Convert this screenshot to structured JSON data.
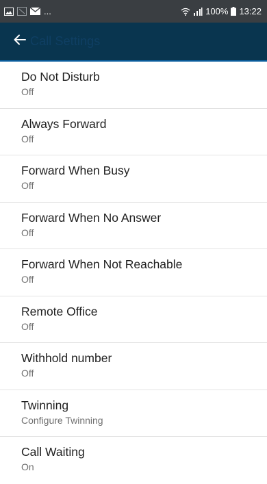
{
  "status_bar": {
    "dots": "...",
    "battery_percent": "100%",
    "time": "13:22",
    "icons": [
      "gallery-icon",
      "image-icon",
      "mail-icon",
      "wifi-icon",
      "signal-icon",
      "battery-icon"
    ]
  },
  "app_bar": {
    "back_icon": "arrow-left-icon",
    "title": "Call Settings",
    "background": "#09354f"
  },
  "settings": [
    {
      "title": "Do Not Disturb",
      "value": "Off"
    },
    {
      "title": "Always Forward",
      "value": "Off"
    },
    {
      "title": "Forward When Busy",
      "value": "Off"
    },
    {
      "title": "Forward When No Answer",
      "value": "Off"
    },
    {
      "title": "Forward When Not Reachable",
      "value": "Off"
    },
    {
      "title": "Remote Office",
      "value": "Off"
    },
    {
      "title": "Withhold number",
      "value": "Off"
    },
    {
      "title": "Twinning",
      "value": "Configure Twinning"
    },
    {
      "title": "Call Waiting",
      "value": "On"
    }
  ]
}
